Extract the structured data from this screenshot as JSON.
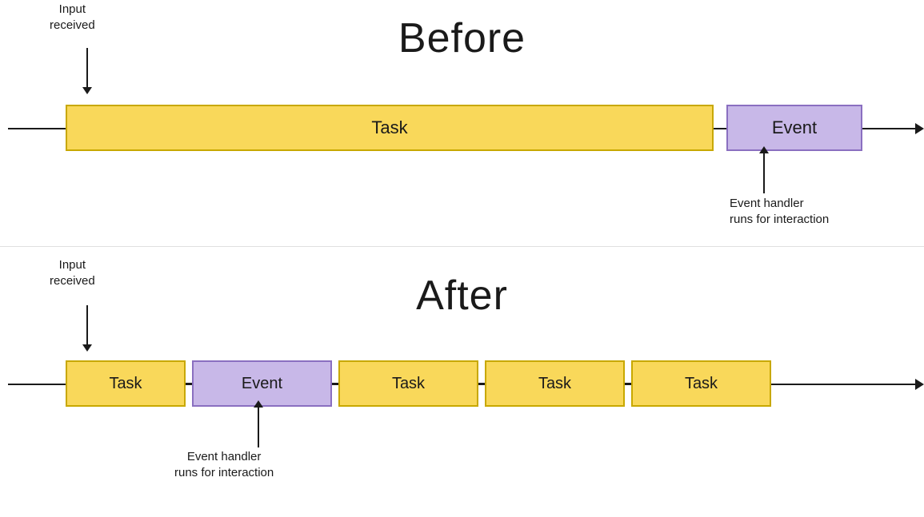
{
  "before": {
    "title": "Before",
    "input_label": "Input\nreceived",
    "task_label": "Task",
    "event_label": "Event",
    "event_handler_label": "Event handler\nruns for interaction"
  },
  "after": {
    "title": "After",
    "input_label": "Input\nreceived",
    "task1_label": "Task",
    "event_label": "Event",
    "task2_label": "Task",
    "task3_label": "Task",
    "task4_label": "Task",
    "event_handler_label": "Event handler\nruns for interaction"
  }
}
